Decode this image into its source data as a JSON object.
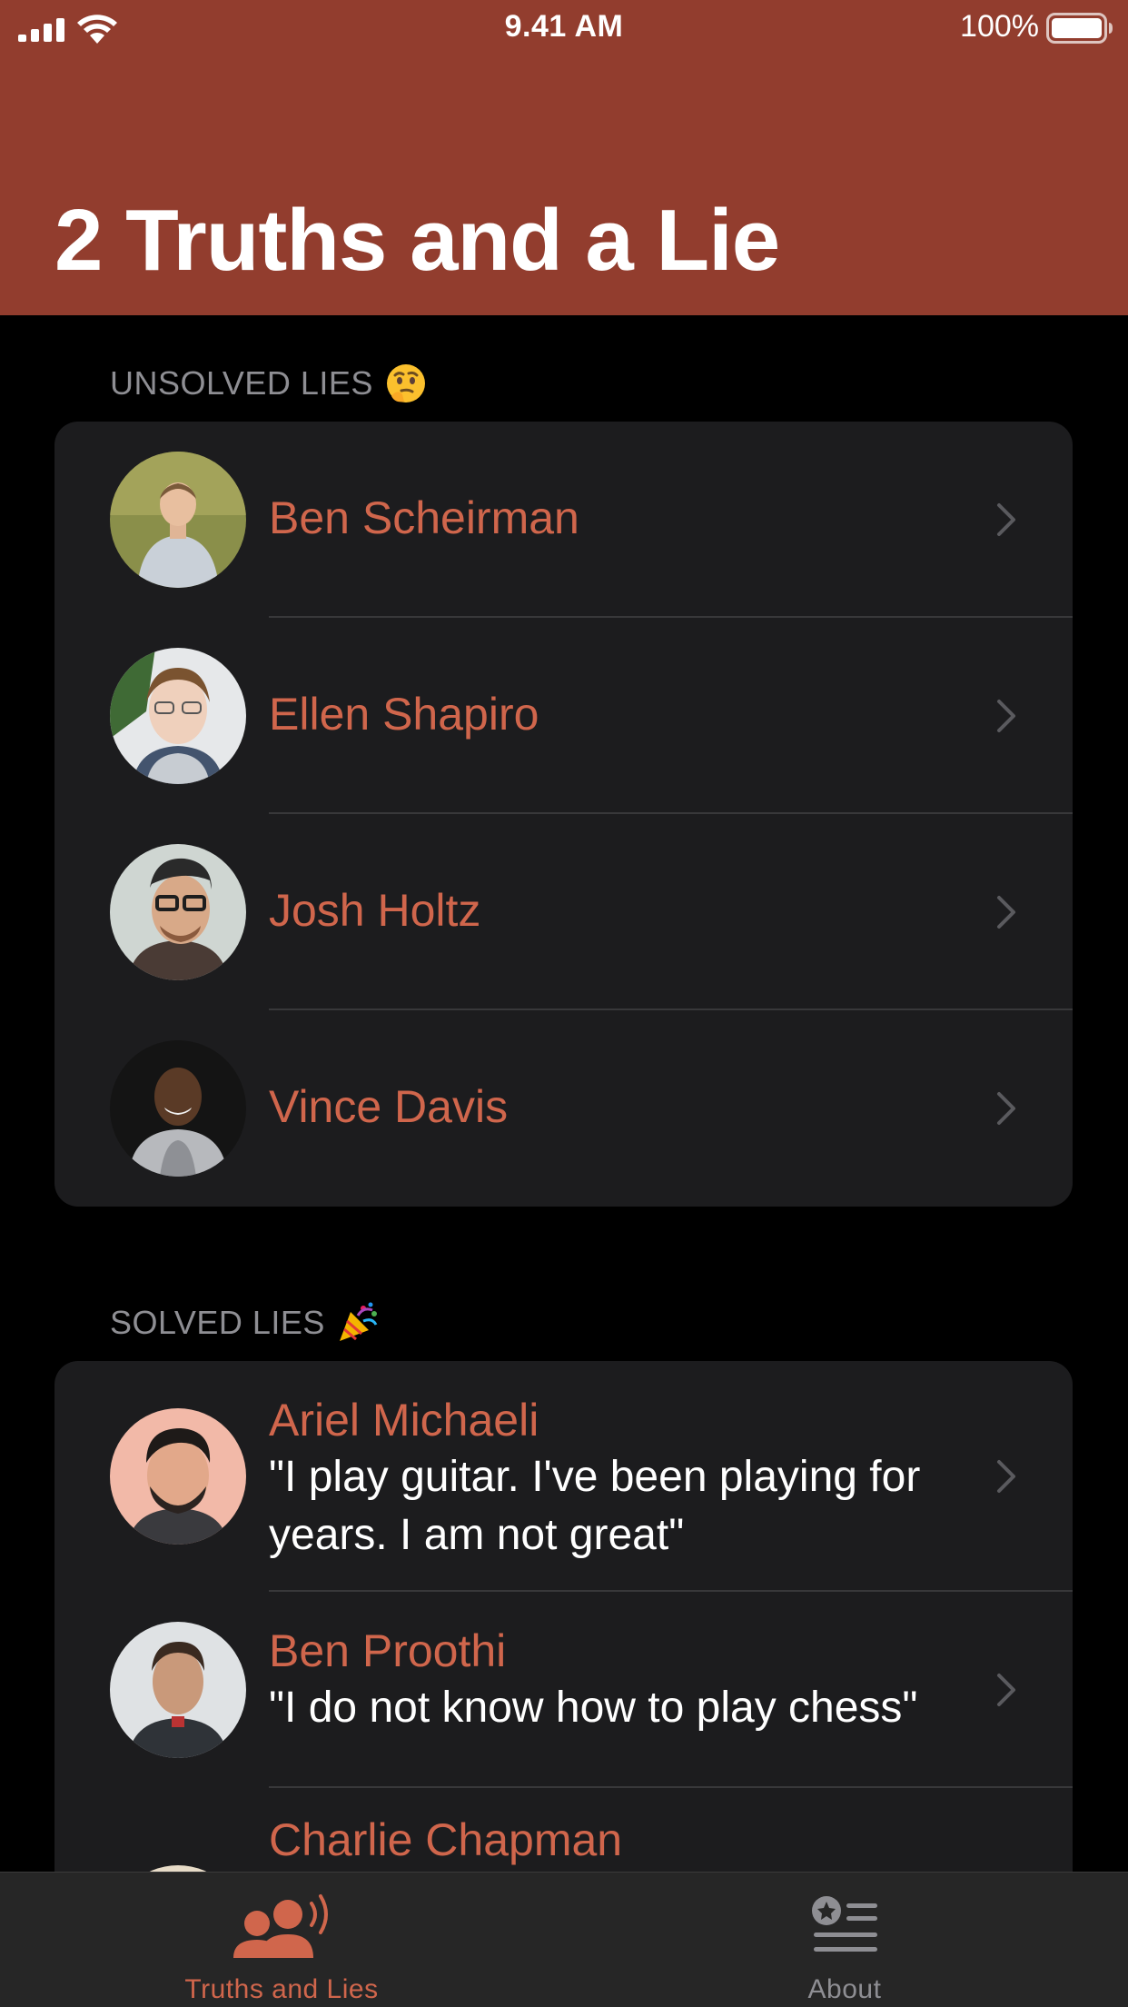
{
  "status_bar": {
    "time": "9.41 AM",
    "battery": "100%"
  },
  "page_title": "2 Truths and a Lie",
  "unsolved": {
    "header": "UNSOLVED LIES",
    "header_emoji": "thinking-face-icon",
    "items": [
      {
        "name": "Ben Scheirman"
      },
      {
        "name": "Ellen Shapiro"
      },
      {
        "name": "Josh Holtz"
      },
      {
        "name": "Vince Davis"
      }
    ]
  },
  "solved": {
    "header": "SOLVED LIES",
    "header_emoji": "party-popper-icon",
    "items": [
      {
        "name": "Ariel Michaeli",
        "quote": "\"I play guitar. I've been playing for years. I am not great\""
      },
      {
        "name": "Ben Proothi",
        "quote": "\"I do not know how to play chess\""
      },
      {
        "name": "Charlie Chapman"
      }
    ]
  },
  "tabs": [
    {
      "label": "Truths and Lies",
      "icon": "people-speaking-icon",
      "selected": true
    },
    {
      "label": "About",
      "icon": "star-list-icon",
      "selected": false
    }
  ],
  "colors": {
    "header_bg": "#923d2e",
    "accent": "#d0664c",
    "card_bg": "#1c1c1e",
    "background": "#000000",
    "tab_inactive": "#8e8e93"
  }
}
